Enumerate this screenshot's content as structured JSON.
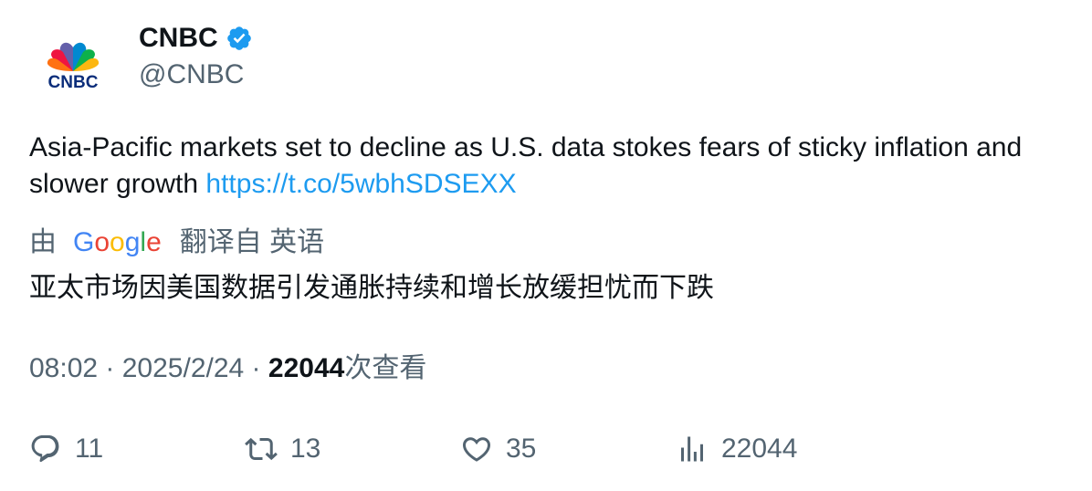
{
  "author": {
    "name": "CNBC",
    "handle": "@CNBC",
    "logo_text": "CNBC",
    "verified_color": "#1d9bf0"
  },
  "tweet": {
    "text": "Asia-Pacific markets set to decline as U.S. data stokes fears of sticky inflation and slower growth ",
    "link": "https://t.co/5wbhSDSEXX"
  },
  "translation": {
    "prefix": "由",
    "provider": "Google",
    "suffix": "翻译自 英语",
    "text": "亚太市场因美国数据引发通胀持续和增长放缓担忧而下跌"
  },
  "meta": {
    "time": "08:02",
    "sep1": " · ",
    "date": "2025/2/24",
    "sep2": " · ",
    "views": "22044",
    "views_label": "次查看"
  },
  "actions": {
    "reply_count": "11",
    "retweet_count": "13",
    "like_count": "35",
    "view_count": "22044"
  },
  "icons": [
    "cnbc-peacock-icon",
    "verified-badge-icon",
    "reply-icon",
    "retweet-icon",
    "like-icon",
    "views-icon"
  ]
}
